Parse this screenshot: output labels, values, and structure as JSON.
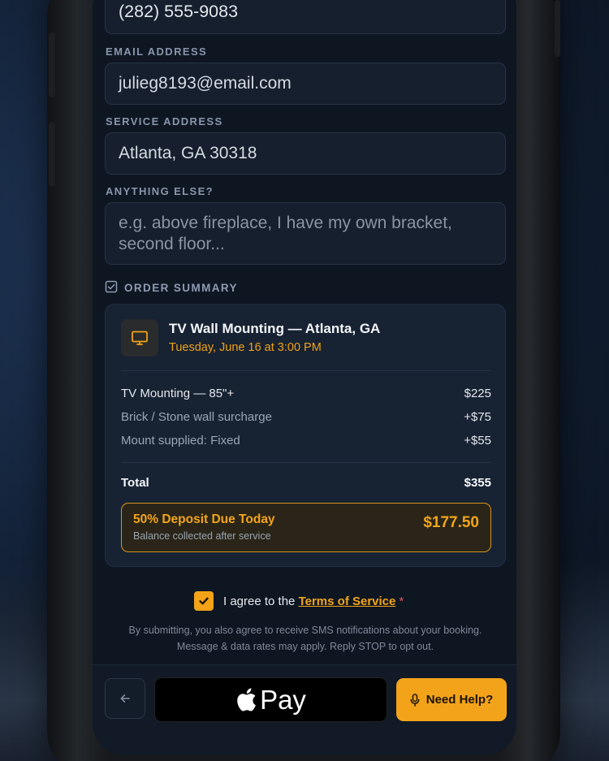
{
  "form": {
    "phone_value": "(282) 555-9083",
    "email_label": "EMAIL ADDRESS",
    "email_value": "julieg8193@email.com",
    "address_label": "SERVICE ADDRESS",
    "address_value": "Atlanta, GA 30318",
    "notes_label": "ANYTHING ELSE?",
    "notes_placeholder_line1": "e.g. above fireplace, I have my own bracket,",
    "notes_placeholder_line2": "second floor..."
  },
  "summary": {
    "heading": "ORDER SUMMARY",
    "service_title": "TV Wall Mounting — Atlanta, GA",
    "service_datetime": "Tuesday, June 16 at 3:00 PM",
    "items": [
      {
        "label": "TV Mounting — 85\"+",
        "value": "$225"
      },
      {
        "label": "Brick / Stone wall surcharge",
        "value": "+$75"
      },
      {
        "label": "Mount supplied: Fixed",
        "value": "+$55"
      }
    ],
    "total_label": "Total",
    "total_value": "$355",
    "deposit_title": "50% Deposit Due Today",
    "deposit_sub": "Balance collected after service",
    "deposit_amount": "$177.50"
  },
  "agreement": {
    "prefix": "I agree to the",
    "link": "Terms of Service",
    "required": "*",
    "checked": true,
    "fine_print_line1": "By submitting, you also agree to receive SMS notifications about your booking.",
    "fine_print_line2": "Message & data rates may apply. Reply STOP to opt out."
  },
  "actions": {
    "pay_label": "Pay",
    "help_label": "Need Help?"
  },
  "icons": {
    "checklist": "checkbox-square-icon",
    "service": "monitor-icon",
    "back": "arrow-left-icon",
    "apple": "apple-logo-icon",
    "help": "microphone-icon"
  },
  "colors": {
    "accent": "#f3a31a",
    "background": "#0e1622",
    "card": "#172232"
  }
}
